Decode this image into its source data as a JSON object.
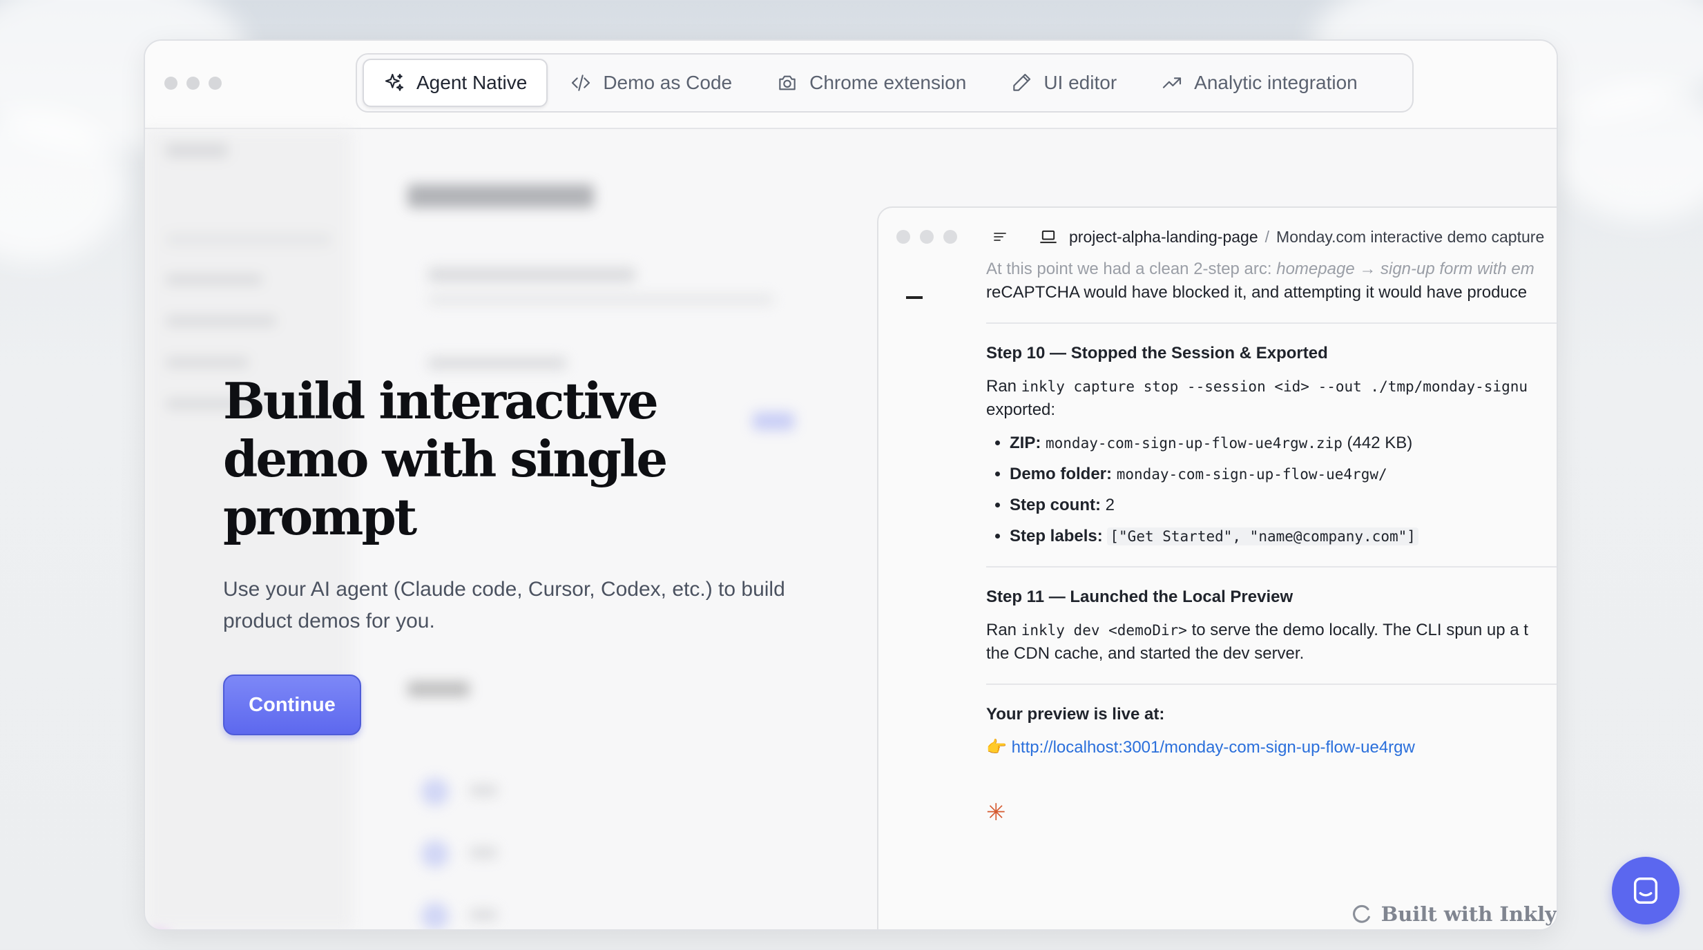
{
  "tabs": [
    {
      "label": "Agent Native",
      "icon": "sparkles-icon",
      "active": true
    },
    {
      "label": "Demo as Code",
      "icon": "code-icon"
    },
    {
      "label": "Chrome extension",
      "icon": "camera-icon"
    },
    {
      "label": "UI editor",
      "icon": "pencil-icon"
    },
    {
      "label": "Analytic integration",
      "icon": "trending-up-icon"
    }
  ],
  "hero": {
    "headline": "Build interactive demo with single prompt",
    "subtitle": "Use your AI agent (Claude code, Cursor, Codex, etc.) to build product demos for you.",
    "cta": "Continue"
  },
  "panel": {
    "project": "project-alpha-landing-page",
    "separator": "/",
    "title": "Monday.com interactive demo capture",
    "intro_faded_prefix": "At this point we had a clean 2-step arc: ",
    "intro_faded_em": "homepage → sign-up form with em",
    "intro_line2": "reCAPTCHA would have blocked it, and attempting it would have produce",
    "step10_title": "Step 10 — Stopped the Session & Exported",
    "step10_ran": "Ran ",
    "step10_cmd": "inkly capture stop --session <id> --out ./tmp/monday-signu",
    "step10_exported": "exported:",
    "items": [
      {
        "label": "ZIP:",
        "value": "monday-com-sign-up-flow-ue4rgw.zip",
        "suffix": " (442 KB)"
      },
      {
        "label": "Demo folder:",
        "value": "monday-com-sign-up-flow-ue4rgw/",
        "suffix": ""
      },
      {
        "label": "Step count:",
        "value": "",
        "suffix": " 2"
      },
      {
        "label": "Step labels:",
        "value": "[\"Get Started\", \"name@company.com\"]",
        "suffix": ""
      }
    ],
    "step11_title": "Step 11 — Launched the Local Preview",
    "step11_ran": "Ran ",
    "step11_cmd": "inkly dev <demoDir>",
    "step11_rest": " to serve the demo locally. The CLI spun up a t",
    "step11_line2": "the CDN cache, and started the dev server.",
    "live_title": "Your preview is live at:",
    "live_emoji": "👉",
    "live_url": "http://localhost:3001/monday-com-sign-up-flow-ue4rgw",
    "spark": "✳",
    "built_with": "Built with Inkly"
  },
  "colors": {
    "accent": "#5b67ef",
    "link": "#2a6fdb",
    "spark": "#d5592f"
  }
}
